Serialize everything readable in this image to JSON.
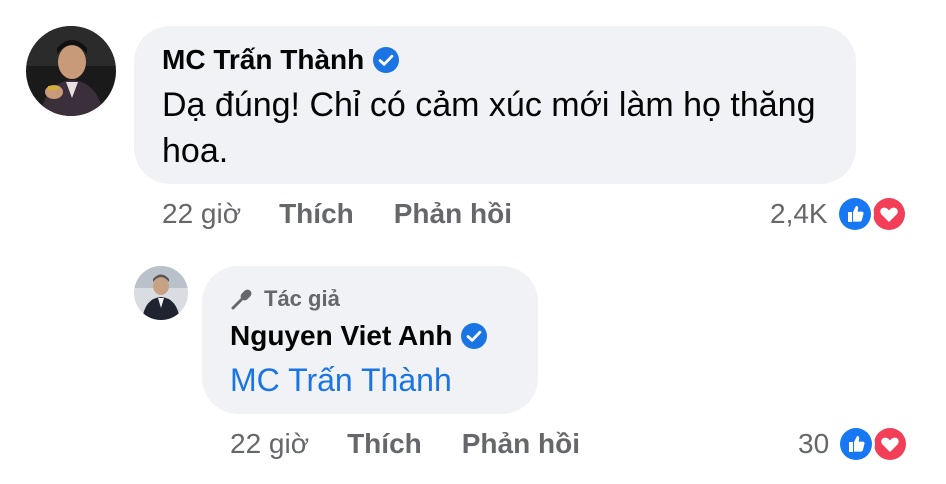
{
  "comment": {
    "author": "MC Trấn Thành",
    "text": "Dạ đúng! Chỉ có cảm xúc mới làm họ thăng hoa.",
    "time": "22 giờ",
    "like_label": "Thích",
    "reply_label": "Phản hồi",
    "reaction_count": "2,4K",
    "avatar_icon": "avatar-man-icon",
    "verified_icon": "verified-badge-icon"
  },
  "reply": {
    "badge": "Tác giả",
    "badge_icon": "microphone-icon",
    "author": "Nguyen Viet Anh",
    "mention": "MC Trấn Thành",
    "time": "22 giờ",
    "like_label": "Thích",
    "reply_label": "Phản hồi",
    "reaction_count": "30",
    "avatar_icon": "avatar-man-icon",
    "verified_icon": "verified-badge-icon"
  },
  "colors": {
    "bubble": "#f0f2f5",
    "meta_text": "#65676b",
    "link": "#1b74e4",
    "verified": "#1b74e4",
    "like": "#1877f2",
    "love": "#f33e58"
  },
  "reaction_icons": [
    "like-icon",
    "love-icon"
  ]
}
